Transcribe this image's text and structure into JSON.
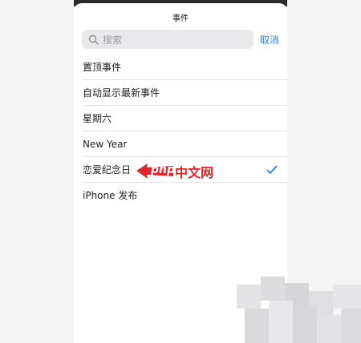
{
  "sheet": {
    "title": "事件"
  },
  "search": {
    "placeholder": "搜索",
    "cancel_label": "取消"
  },
  "events": [
    {
      "label": "置顶事件",
      "selected": false
    },
    {
      "label": "自动显示最新事件",
      "selected": false
    },
    {
      "label": "星期六",
      "selected": false
    },
    {
      "label": "New Year",
      "selected": false
    },
    {
      "label": "恋爱纪念日",
      "selected": true
    },
    {
      "label": "iPhone 发布",
      "selected": false
    }
  ],
  "watermark": {
    "prefix": "php",
    "suffix": "中文网"
  },
  "colors": {
    "accent": "#2f7fd8",
    "watermark_red": "#d8262b"
  },
  "icons": {
    "search": "search-icon",
    "check": "checkmark-icon",
    "arrow": "arrow-left-icon"
  }
}
